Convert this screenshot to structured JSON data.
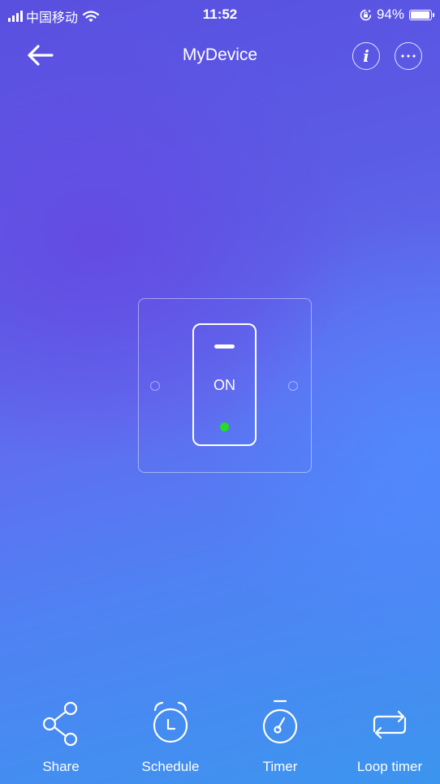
{
  "status_bar": {
    "carrier": "中国移动",
    "time": "11:52",
    "battery": "94%",
    "battery_level": 0.94,
    "icons": [
      "signal-icon",
      "wifi-icon",
      "rotation-lock-icon",
      "battery-icon"
    ]
  },
  "header": {
    "title": "MyDevice",
    "icons": [
      "back-arrow-icon",
      "info-icon",
      "more-icon"
    ]
  },
  "switch": {
    "state_label": "ON",
    "indicator_color": "#22e020"
  },
  "toolbar": {
    "items": [
      {
        "label": "Share",
        "icon": "share-icon"
      },
      {
        "label": "Schedule",
        "icon": "alarm-clock-icon"
      },
      {
        "label": "Timer",
        "icon": "stopwatch-icon"
      },
      {
        "label": "Loop timer",
        "icon": "loop-icon"
      }
    ]
  },
  "colors": {
    "background_top": "#5a4fe0",
    "background_bottom": "#3c95ef",
    "text": "#ffffff"
  }
}
